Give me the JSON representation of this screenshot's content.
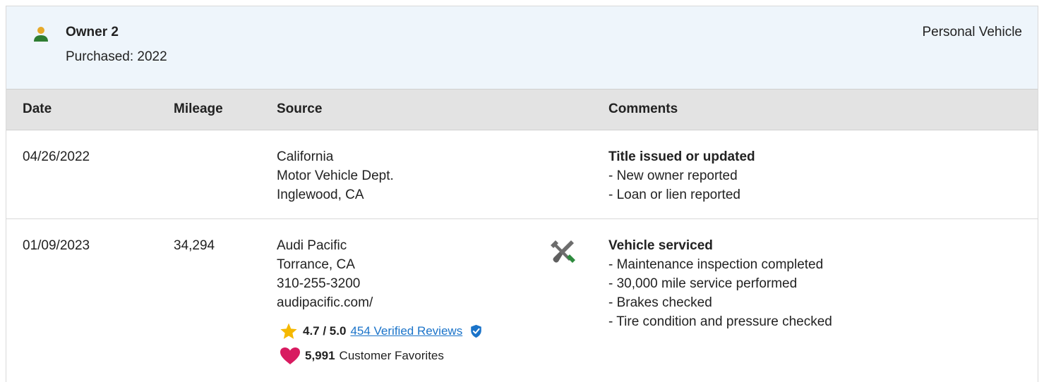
{
  "owner": {
    "name": "Owner 2",
    "purchased": "Purchased: 2022",
    "type": "Personal Vehicle"
  },
  "columns": {
    "date": "Date",
    "mileage": "Mileage",
    "source": "Source",
    "comments": "Comments"
  },
  "records": [
    {
      "date": "04/26/2022",
      "mileage": "",
      "source": [
        "California",
        "Motor Vehicle Dept.",
        "Inglewood, CA"
      ],
      "comment_title": "Title issued or updated",
      "comments": [
        "- New owner reported",
        "- Loan or lien reported"
      ]
    },
    {
      "date": "01/09/2023",
      "mileage": "34,294",
      "source": [
        "Audi Pacific",
        "Torrance, CA",
        "310-255-3200",
        "audipacific.com/"
      ],
      "icon": "tools-icon",
      "rating": {
        "score": "4.7 / 5.0",
        "reviews_link": "454 Verified Reviews"
      },
      "favorites": {
        "count": "5,991",
        "label": "Customer Favorites"
      },
      "comment_title": "Vehicle serviced",
      "comments": [
        "- Maintenance inspection completed",
        "- 30,000 mile service performed",
        "- Brakes checked",
        "- Tire condition and pressure checked"
      ]
    }
  ],
  "colors": {
    "owner_icon": "#2e7d32",
    "header_bg": "#eef5fb",
    "table_head_bg": "#e3e3e3",
    "link": "#1a73c9",
    "star": "#f5b800",
    "heart": "#d81b60",
    "shield": "#1a73c9"
  }
}
